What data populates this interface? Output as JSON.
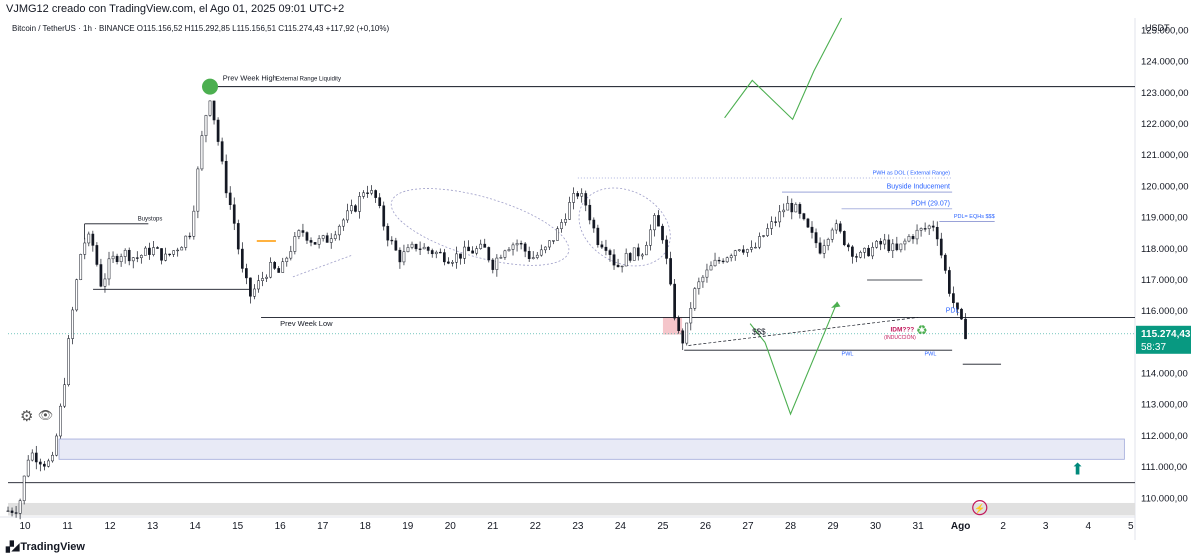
{
  "header": {
    "created_by": "VJMG12 creado con TradingView.com, el Ago 01, 2025 09:01 UTC+2"
  },
  "footer": {
    "brand": "TradingView",
    "logo_glyph": "▞◢"
  },
  "colors": {
    "candle": "#131722",
    "level_line": "#131722",
    "green_path": "#4caf50",
    "zone_fill": "#e8eaf6",
    "zone_border": "#9fa8da",
    "red_zone": "#f5c6cb",
    "blue_text": "#2962ff",
    "orange": "#ff9800",
    "price_label": "#089981",
    "current_price_line": "#26a69a",
    "dot_green": "#4caf50",
    "teal_arrow": "#00897b",
    "magenta": "#c2185b"
  },
  "chart_data": {
    "type": "candlestick",
    "legend": "Bitcoin / TetherUS · 1h · BINANCE  O115.156,52  H115.292,85  L115.156,51  C115.274,43  +117,92 (+0,10%)",
    "currency": "USDT",
    "ylim": [
      109400,
      125400
    ],
    "yticks": [
      110000,
      111000,
      112000,
      113000,
      114000,
      115000,
      116000,
      117000,
      118000,
      119000,
      120000,
      121000,
      122000,
      123000,
      124000,
      125000
    ],
    "ytick_labels": [
      "110.000,00",
      "111.000,00",
      "112.000,00",
      "113.000,00",
      "114.000,00",
      "115.000,00",
      "116.000,00",
      "117.000,00",
      "118.000,00",
      "119.000,00",
      "120.000,00",
      "121.000,00",
      "122.000,00",
      "123.000,00",
      "124.000,00",
      "125.000,00"
    ],
    "xlim": [
      9.6,
      36.1
    ],
    "xticks": [
      10,
      11,
      12,
      13,
      14,
      15,
      16,
      17,
      18,
      19,
      20,
      21,
      22,
      23,
      24,
      25,
      26,
      27,
      28,
      29,
      30,
      31,
      32,
      33,
      34,
      35,
      36
    ],
    "xtick_labels": [
      "10",
      "11",
      "12",
      "13",
      "14",
      "15",
      "16",
      "17",
      "18",
      "19",
      "20",
      "21",
      "22",
      "23",
      "24",
      "25",
      "26",
      "27",
      "28",
      "29",
      "30",
      "31",
      "Ago",
      "2",
      "3",
      "4",
      "5"
    ],
    "current_price": {
      "value": 115274.43,
      "label": "115.274,43",
      "countdown": "58:37"
    },
    "price_path": [
      [
        9.6,
        109600
      ],
      [
        9.85,
        109700
      ],
      [
        10.0,
        110800
      ],
      [
        10.1,
        111500
      ],
      [
        10.3,
        111300
      ],
      [
        10.5,
        111100
      ],
      [
        10.65,
        111200
      ],
      [
        10.8,
        112500
      ],
      [
        10.95,
        114000
      ],
      [
        11.05,
        115300
      ],
      [
        11.15,
        116300
      ],
      [
        11.3,
        117800
      ],
      [
        11.45,
        118400
      ],
      [
        11.6,
        118100
      ],
      [
        11.8,
        116800
      ],
      [
        12.0,
        117600
      ],
      [
        12.3,
        117900
      ],
      [
        12.6,
        117700
      ],
      [
        13.0,
        118000
      ],
      [
        13.3,
        117700
      ],
      [
        13.7,
        118200
      ],
      [
        13.9,
        118600
      ],
      [
        14.05,
        120300
      ],
      [
        14.2,
        122000
      ],
      [
        14.35,
        122900
      ],
      [
        14.5,
        121800
      ],
      [
        14.7,
        120100
      ],
      [
        14.9,
        119000
      ],
      [
        15.1,
        117300
      ],
      [
        15.3,
        116500
      ],
      [
        15.5,
        116900
      ],
      [
        15.75,
        117400
      ],
      [
        16.0,
        117200
      ],
      [
        16.2,
        117900
      ],
      [
        16.5,
        118600
      ],
      [
        16.8,
        118200
      ],
      [
        17.1,
        118300
      ],
      [
        17.4,
        118800
      ],
      [
        17.8,
        119400
      ],
      [
        18.0,
        120000
      ],
      [
        18.25,
        119600
      ],
      [
        18.5,
        118500
      ],
      [
        18.8,
        117700
      ],
      [
        19.2,
        118100
      ],
      [
        19.6,
        117900
      ],
      [
        20.0,
        117700
      ],
      [
        20.4,
        117900
      ],
      [
        20.8,
        118000
      ],
      [
        21.0,
        117500
      ],
      [
        21.3,
        118100
      ],
      [
        21.6,
        118200
      ],
      [
        21.9,
        117700
      ],
      [
        22.2,
        117900
      ],
      [
        22.5,
        118500
      ],
      [
        22.8,
        119400
      ],
      [
        23.0,
        119800
      ],
      [
        23.2,
        119400
      ],
      [
        23.45,
        118300
      ],
      [
        23.7,
        118100
      ],
      [
        23.9,
        117400
      ],
      [
        24.2,
        117800
      ],
      [
        24.5,
        117900
      ],
      [
        24.8,
        118900
      ],
      [
        25.0,
        118400
      ],
      [
        25.2,
        116500
      ],
      [
        25.35,
        115300
      ],
      [
        25.5,
        115000
      ],
      [
        25.7,
        116500
      ],
      [
        25.9,
        117000
      ],
      [
        26.2,
        117500
      ],
      [
        26.5,
        117800
      ],
      [
        26.8,
        118100
      ],
      [
        27.1,
        117900
      ],
      [
        27.4,
        118500
      ],
      [
        27.7,
        119000
      ],
      [
        27.9,
        119400
      ],
      [
        28.1,
        119300
      ],
      [
        28.4,
        118600
      ],
      [
        28.7,
        118000
      ],
      [
        29.0,
        118800
      ],
      [
        29.3,
        118200
      ],
      [
        29.6,
        117700
      ],
      [
        29.9,
        118000
      ],
      [
        30.2,
        118200
      ],
      [
        30.5,
        117900
      ],
      [
        30.8,
        118400
      ],
      [
        31.1,
        118600
      ],
      [
        31.4,
        118800
      ],
      [
        31.55,
        117800
      ],
      [
        31.75,
        116600
      ],
      [
        31.95,
        115800
      ],
      [
        32.1,
        115300
      ],
      [
        32.2,
        115270
      ]
    ],
    "levels": [
      {
        "name": "prev-week-high",
        "price": 123200,
        "x_from": 14.35,
        "x_to": 36.1,
        "label": "Prev Week High"
      },
      {
        "name": "prev-week-low",
        "price": 115800,
        "x_from": 15.55,
        "x_to": 36.1,
        "label": "Prev Week Low"
      },
      {
        "name": "buystops",
        "price": 118800,
        "x_from": 11.4,
        "x_to": 12.9,
        "label": "Buystops"
      },
      {
        "name": "pwh-dol",
        "price": 120270,
        "x_from": 23.0,
        "x_to": 31.8,
        "label": "PWH as DOL ( External Range)"
      },
      {
        "name": "buyside-inducement",
        "price": 119820,
        "x_from": 27.8,
        "x_to": 31.8,
        "label": "Buyside Inducement"
      },
      {
        "name": "pdh",
        "price": 119280,
        "x_from": 29.2,
        "x_to": 31.8,
        "label": "PDH (29.07)"
      },
      {
        "name": "pdl-eqhs",
        "price": 118880,
        "x_from": 31.5,
        "x_to": 32.8,
        "label": "PDL= EQHs $$$"
      },
      {
        "name": "pwl",
        "price": 114750,
        "x_from": 25.5,
        "x_to": 31.8,
        "label": "PWL"
      },
      {
        "name": "lower-low",
        "price": 114300,
        "x_from": 32.05,
        "x_to": 32.95,
        "label": ""
      },
      {
        "name": "floor",
        "price": 110500,
        "x_from": 9.6,
        "x_to": 36.1,
        "label": ""
      }
    ],
    "annotations": {
      "external_range_liquidity": "External Range Liquidity",
      "pdl": "PDL",
      "pwl_right": "PWL",
      "dollars": "$$$",
      "idm": "IDM???",
      "induccion": "(INDUCCIÓN)",
      "gear_icon": "⚙",
      "eye_icon": "👁",
      "recycle_icon": "♻",
      "bolt_icon": "⚡",
      "up_arrow": "⬆"
    }
  }
}
